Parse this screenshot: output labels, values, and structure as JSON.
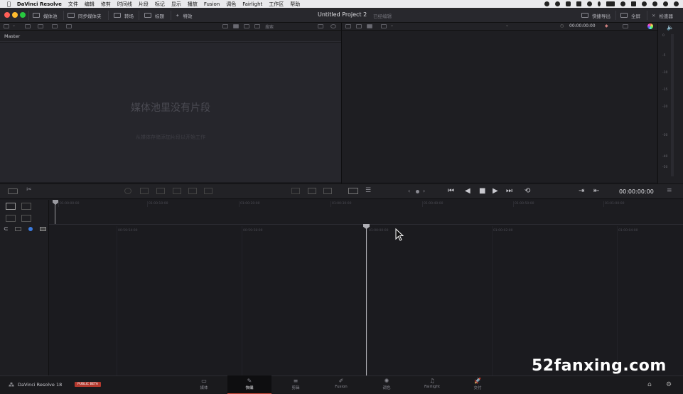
{
  "menubar": {
    "app": "DaVinci Resolve",
    "items": [
      "文件",
      "编辑",
      "修剪",
      "时间线",
      "片段",
      "标记",
      "显示",
      "播放",
      "Fusion",
      "调色",
      "Fairlight",
      "工作区",
      "帮助"
    ]
  },
  "toolbar": {
    "media_pool": "媒体池",
    "sync_bin": "同步媒体夹",
    "transitions": "转场",
    "titles": "标题",
    "effects": "特效",
    "project_title": "Untitled Project 2",
    "edited": "已经编辑",
    "quick_export": "快捷导出",
    "fullscreen": "全屏",
    "inspector": "检查器"
  },
  "media_pool": {
    "search_label": "搜索",
    "bin": "Master",
    "empty_title": "媒体池里没有片段",
    "empty_hint": "从媒体存储添加片段以开始工作"
  },
  "viewer": {
    "timecode_top": "00:00:00:00",
    "timecode": "00:00:00:00"
  },
  "meter": {
    "ticks": [
      "0",
      "-5",
      "-10",
      "-15",
      "-20",
      "-30",
      "-40",
      "-50"
    ]
  },
  "timeline": {
    "upper_ruler": [
      "01:00:00:00",
      "01:00:10:00",
      "01:00:20:00",
      "01:00:30:00",
      "01:00:40:00",
      "01:00:50:00",
      "01:01:00:00"
    ],
    "lower_ruler": [
      "00:59:54:00",
      "00:59:58:00",
      "01:00:00:00",
      "01:00:02:00",
      "01:00:04:00"
    ]
  },
  "bottom_nav": {
    "brand": "DaVinci Resolve 18",
    "badge": "PUBLIC BETA",
    "pages": [
      {
        "label": "媒体",
        "glyph": "▭"
      },
      {
        "label": "快编",
        "glyph": "✎"
      },
      {
        "label": "剪辑",
        "glyph": "≡"
      },
      {
        "label": "Fusion",
        "glyph": "✐"
      },
      {
        "label": "调色",
        "glyph": "✺"
      },
      {
        "label": "Fairlight",
        "glyph": "♫"
      },
      {
        "label": "交付",
        "glyph": "🚀"
      }
    ],
    "active_index": 1
  },
  "watermark": "52fanxing.com",
  "colors": {
    "close": "#ff5f57",
    "minimize": "#febc2e",
    "zoom": "#28c840",
    "accent": "#d24a3a"
  }
}
